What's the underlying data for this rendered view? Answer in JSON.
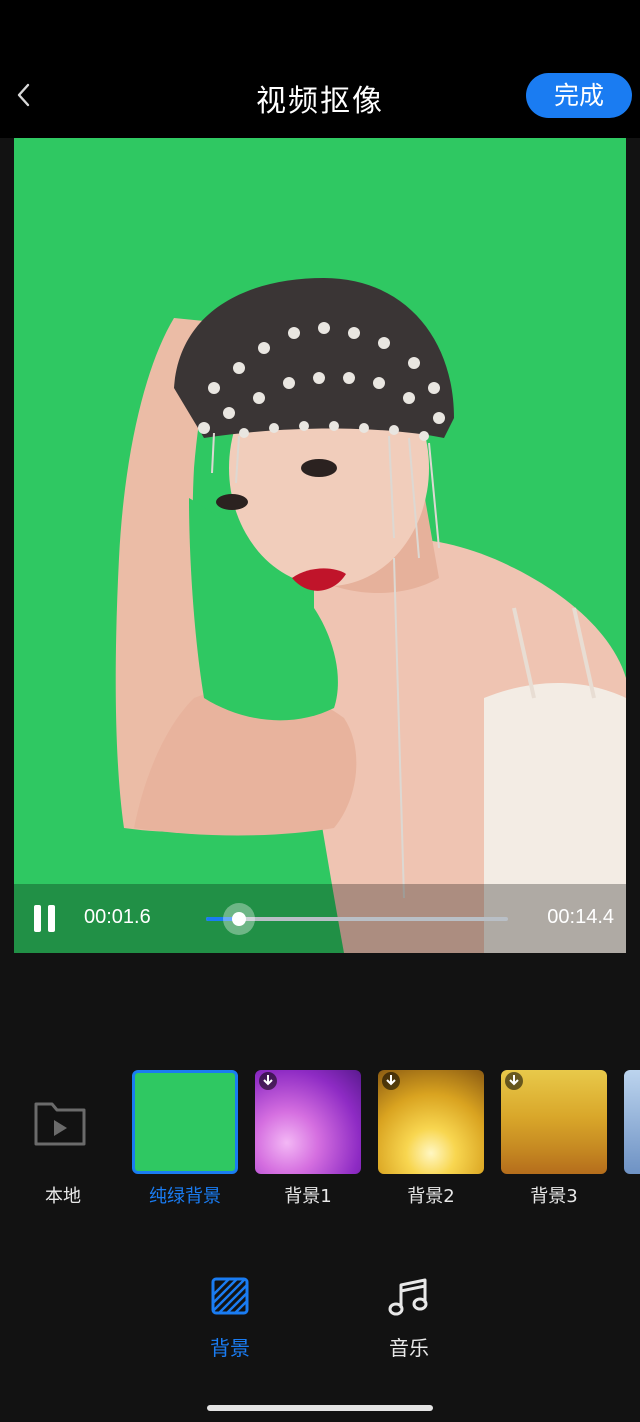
{
  "header": {
    "title": "视频抠像",
    "done_label": "完成",
    "back_icon": "chevron-left-icon"
  },
  "player": {
    "current_time": "00:01.6",
    "total_time": "00:14.4",
    "progress": 0.11,
    "state_icon": "pause-icon"
  },
  "backgrounds": [
    {
      "label": "本地",
      "icon": "folder-video-icon"
    },
    {
      "label": "纯绿背景",
      "selected": true,
      "color": "#2fc862"
    },
    {
      "label": "背景1",
      "downloadable": true
    },
    {
      "label": "背景2",
      "downloadable": true
    },
    {
      "label": "背景3",
      "downloadable": true
    }
  ],
  "tabs": [
    {
      "label": "背景",
      "active": true,
      "icon": "hatched-square-icon"
    },
    {
      "label": "音乐",
      "active": false,
      "icon": "music-note-icon"
    }
  ],
  "colors": {
    "accent": "#1a7cf2",
    "chroma_green": "#2fc862",
    "background": "#121212"
  }
}
